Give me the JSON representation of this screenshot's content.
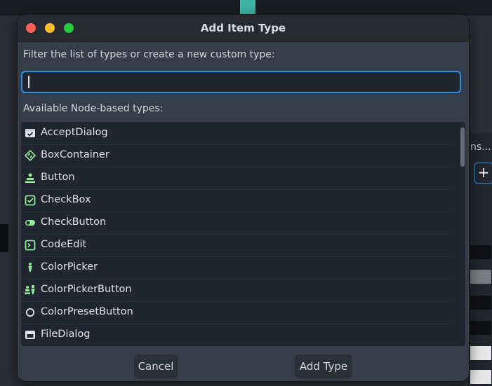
{
  "dialog": {
    "title": "Add Item Type",
    "filter_label": "Filter the list of types or create a new custom type:",
    "filter_value": "",
    "available_label": "Available Node-based types:",
    "types": [
      {
        "label": "AcceptDialog",
        "icon": "accept-dialog-icon"
      },
      {
        "label": "BoxContainer",
        "icon": "box-container-icon"
      },
      {
        "label": "Button",
        "icon": "button-icon"
      },
      {
        "label": "CheckBox",
        "icon": "checkbox-icon"
      },
      {
        "label": "CheckButton",
        "icon": "check-button-icon"
      },
      {
        "label": "CodeEdit",
        "icon": "code-edit-icon"
      },
      {
        "label": "ColorPicker",
        "icon": "color-picker-icon"
      },
      {
        "label": "ColorPickerButton",
        "icon": "color-picker-button-icon"
      },
      {
        "label": "ColorPresetButton",
        "icon": "color-preset-button-icon"
      },
      {
        "label": "FileDialog",
        "icon": "file-dialog-icon"
      }
    ],
    "cancel_label": "Cancel",
    "add_label": "Add Type",
    "icon_color": "#8eef97"
  },
  "background": {
    "partial_text": "ns...",
    "plus_label": "+"
  },
  "colors": {
    "accent": "#2d8fd6",
    "close": "#ff5f57",
    "minimize": "#febc2e",
    "maximize": "#28c840"
  }
}
